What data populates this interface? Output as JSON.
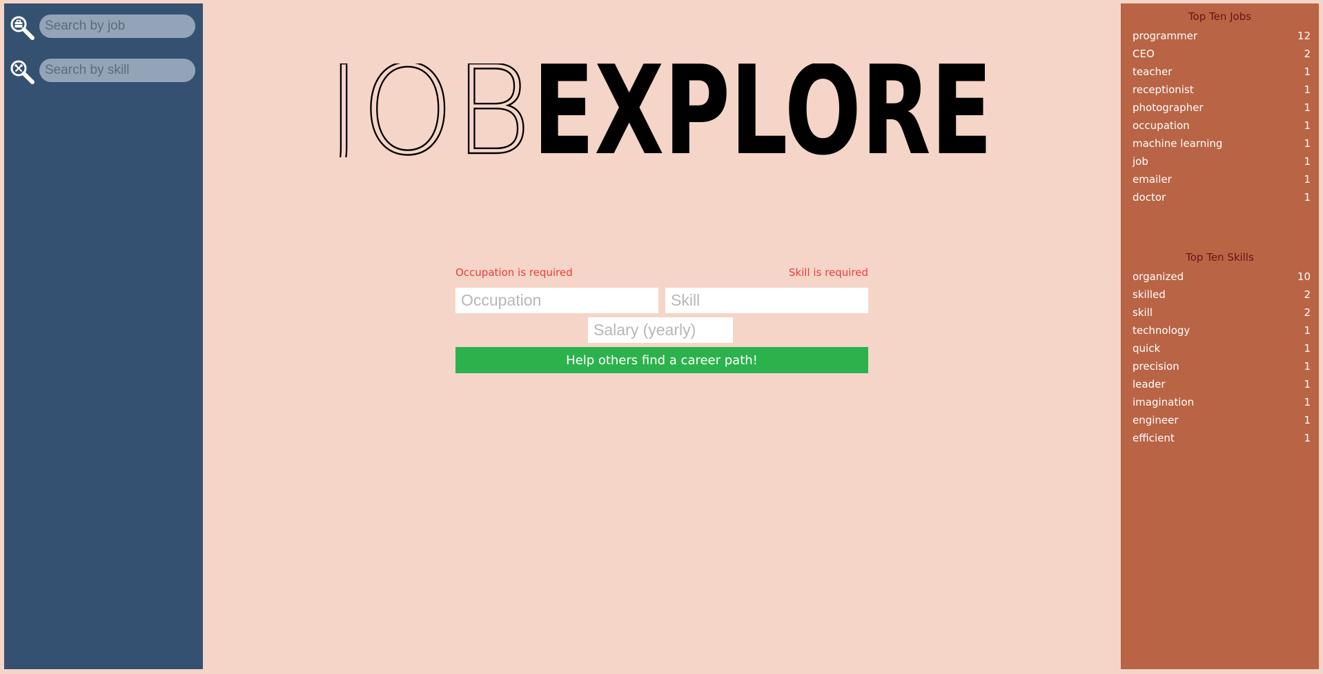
{
  "sidebar": {
    "job_search": {
      "placeholder": "Search by job",
      "icon": "briefcase-search-icon"
    },
    "skill_search": {
      "placeholder": "Search by skill",
      "icon": "skill-search-icon"
    }
  },
  "logo": {
    "light_text": "JOB",
    "bold_text": "EXPLORE"
  },
  "form": {
    "occupation_error": "Occupation is required",
    "skill_error": "Skill is required",
    "occupation_placeholder": "Occupation",
    "skill_placeholder": "Skill",
    "salary_placeholder": "Salary (yearly)",
    "submit_label": "Help others find a career path!"
  },
  "top_jobs": {
    "title": "Top Ten Jobs",
    "items": [
      {
        "name": "programmer",
        "count": "12"
      },
      {
        "name": "CEO",
        "count": "2"
      },
      {
        "name": "teacher",
        "count": "1"
      },
      {
        "name": "receptionist",
        "count": "1"
      },
      {
        "name": "photographer",
        "count": "1"
      },
      {
        "name": "occupation",
        "count": "1"
      },
      {
        "name": "machine learning",
        "count": "1"
      },
      {
        "name": "job",
        "count": "1"
      },
      {
        "name": "emailer",
        "count": "1"
      },
      {
        "name": "doctor",
        "count": "1"
      }
    ]
  },
  "top_skills": {
    "title": "Top Ten Skills",
    "items": [
      {
        "name": "organized",
        "count": "10"
      },
      {
        "name": "skilled",
        "count": "2"
      },
      {
        "name": "skill",
        "count": "2"
      },
      {
        "name": "technology",
        "count": "1"
      },
      {
        "name": "quick",
        "count": "1"
      },
      {
        "name": "precision",
        "count": "1"
      },
      {
        "name": "leader",
        "count": "1"
      },
      {
        "name": "imagination",
        "count": "1"
      },
      {
        "name": "engineer",
        "count": "1"
      },
      {
        "name": "efficient",
        "count": "1"
      }
    ]
  },
  "colors": {
    "page_background": "#f5d5c8",
    "left_sidebar": "#355172",
    "right_sidebar": "#b96445",
    "panel_title": "#6a1416",
    "error": "#ea3c3c",
    "submit": "#2cb24d"
  }
}
